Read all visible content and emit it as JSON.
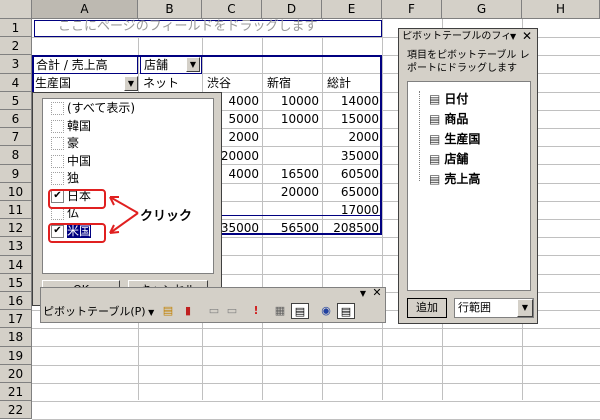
{
  "columns": [
    "A",
    "B",
    "C",
    "D",
    "E",
    "F",
    "G",
    "H"
  ],
  "rows": [
    "1",
    "2",
    "3",
    "4",
    "5",
    "6",
    "7",
    "8",
    "9",
    "10",
    "11",
    "12",
    "13",
    "14",
    "15",
    "16",
    "17",
    "18",
    "19",
    "20",
    "21",
    "22"
  ],
  "sheet": {
    "drop_page_hint": "ここにページのフィールドをドラッグします",
    "data_field": "合計 / 売上高",
    "col_field": "店舗",
    "row_field": "生産国",
    "col_headers": [
      "ネット",
      "渋谷",
      "新宿",
      "総計"
    ],
    "values": [
      [
        "",
        "4000",
        "10000",
        "14000"
      ],
      [
        "",
        "5000",
        "10000",
        "15000"
      ],
      [
        "",
        "2000",
        "",
        "2000"
      ],
      [
        "",
        "20000",
        "",
        "35000"
      ],
      [
        "",
        "4000",
        "16500",
        "60500"
      ],
      [
        "",
        "",
        "20000",
        "65000"
      ],
      [
        "",
        "",
        "",
        "17000"
      ],
      [
        "",
        "35000",
        "56500",
        "208500"
      ]
    ]
  },
  "filter_popup": {
    "items": [
      {
        "label": "(すべて表示)",
        "checked": false
      },
      {
        "label": "韓国",
        "checked": false
      },
      {
        "label": "豪",
        "checked": false
      },
      {
        "label": "中国",
        "checked": false
      },
      {
        "label": "独",
        "checked": false
      },
      {
        "label": "日本",
        "checked": true
      },
      {
        "label": "仏",
        "checked": false
      },
      {
        "label": "米国",
        "checked": true
      }
    ],
    "ok_label": "OK",
    "cancel_label": "キャンセル",
    "annotation": "クリック"
  },
  "pivot_toolbar": {
    "menu_label": "ピボットテーブル(P)",
    "icons": [
      "format-report-icon",
      "chart-wizard-icon",
      "hide-detail-icon",
      "show-detail-icon",
      "refresh-icon",
      "field-settings-icon",
      "field-list-icon",
      "always-display-icon",
      "show-fields-icon"
    ]
  },
  "field_list": {
    "title": "ピボットテーブルのフィ",
    "instruction": "項目をピボットテーブル レポートにドラッグします",
    "fields": [
      "日付",
      "商品",
      "生産国",
      "店舗",
      "売上高"
    ],
    "add_button": "追加",
    "area_select": "行範囲"
  },
  "colors": {
    "chrome": "#d4d0c8",
    "selection": "#000080",
    "annotation_red": "#e02020",
    "pivot_border": "#000080"
  }
}
